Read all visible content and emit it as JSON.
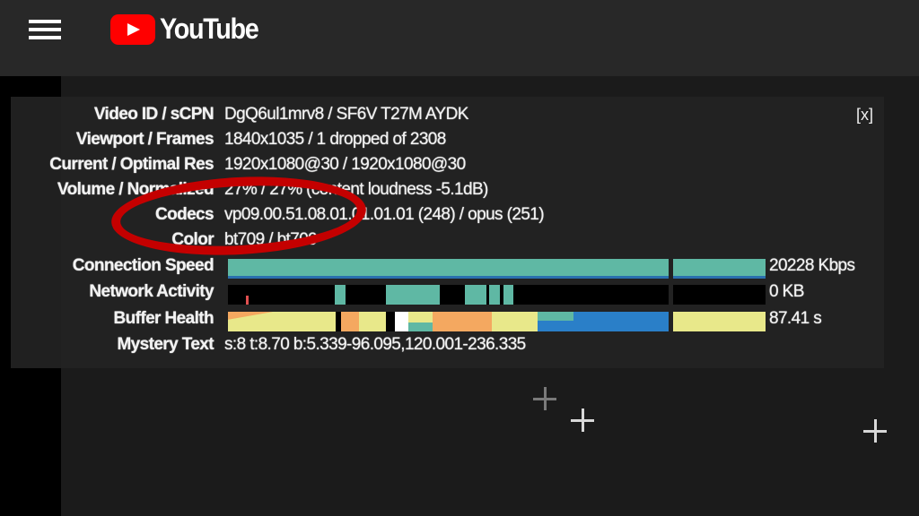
{
  "header": {
    "logo_text": "YouTube",
    "menu_icon": "hamburger-icon",
    "brand_color": "#ff0000"
  },
  "stats": {
    "close_label": "[x]",
    "rows": [
      {
        "label": "Video ID / sCPN",
        "value": "DgQ6ul1mrv8 / SF6V T27M AYDK"
      },
      {
        "label": "Viewport / Frames",
        "value": "1840x1035 / 1 dropped of 2308"
      },
      {
        "label": "Current / Optimal Res",
        "value": "1920x1080@30 / 1920x1080@30"
      },
      {
        "label": "Volume / Normalized",
        "value": "27% / 27% (content loudness -5.1dB)"
      },
      {
        "label": "Codecs",
        "value": "vp09.00.51.08.01.01.01.01 (248) / opus (251)"
      },
      {
        "label": "Color",
        "value": "bt709 / bt709"
      }
    ],
    "connection_speed": {
      "label": "Connection Speed",
      "value": "20228 Kbps",
      "color": "#5fb8a4"
    },
    "network_activity": {
      "label": "Network Activity",
      "value": "0 KB"
    },
    "buffer_health": {
      "label": "Buffer Health",
      "value": "87.41 s"
    },
    "mystery_text": {
      "label": "Mystery Text",
      "value": "s:8 t:8.70 b:5.339-96.095,120.001-236.335"
    }
  },
  "annotation": {
    "color": "#c40000"
  }
}
